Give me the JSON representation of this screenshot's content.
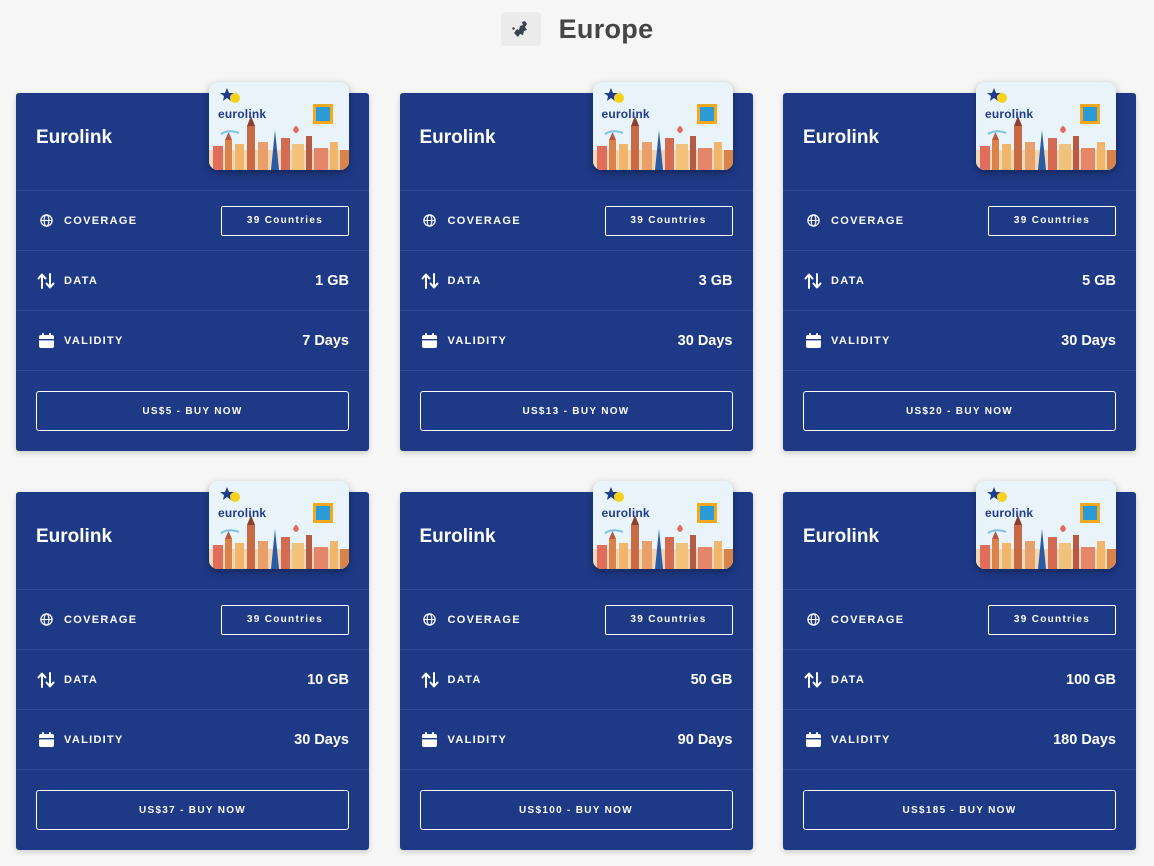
{
  "header": {
    "region_icon": "europe-map-icon",
    "title": "Europe"
  },
  "colors": {
    "page_background": "#f6f6f6",
    "card_background": "#1e3a87",
    "card_divider": "#2f4c99",
    "text": "#ffffff",
    "title_text": "#454545"
  },
  "labels": {
    "coverage": "COVERAGE",
    "data": "DATA",
    "validity": "VALIDITY"
  },
  "icons": {
    "coverage": "globe-icon",
    "data": "up-down-arrows-icon",
    "validity": "calendar-icon"
  },
  "cards": [
    {
      "name": "Eurolink",
      "sim_brand": "eurolink",
      "coverage": "39 Countries",
      "data": "1 GB",
      "validity": "7 Days",
      "buy_label": "US$5 - BUY NOW"
    },
    {
      "name": "Eurolink",
      "sim_brand": "eurolink",
      "coverage": "39 Countries",
      "data": "3 GB",
      "validity": "30 Days",
      "buy_label": "US$13 - BUY NOW"
    },
    {
      "name": "Eurolink",
      "sim_brand": "eurolink",
      "coverage": "39 Countries",
      "data": "5 GB",
      "validity": "30 Days",
      "buy_label": "US$20 - BUY NOW"
    },
    {
      "name": "Eurolink",
      "sim_brand": "eurolink",
      "coverage": "39 Countries",
      "data": "10 GB",
      "validity": "30 Days",
      "buy_label": "US$37 - BUY NOW"
    },
    {
      "name": "Eurolink",
      "sim_brand": "eurolink",
      "coverage": "39 Countries",
      "data": "50 GB",
      "validity": "90 Days",
      "buy_label": "US$100 - BUY NOW"
    },
    {
      "name": "Eurolink",
      "sim_brand": "eurolink",
      "coverage": "39 Countries",
      "data": "100 GB",
      "validity": "180 Days",
      "buy_label": "US$185 - BUY NOW"
    }
  ]
}
